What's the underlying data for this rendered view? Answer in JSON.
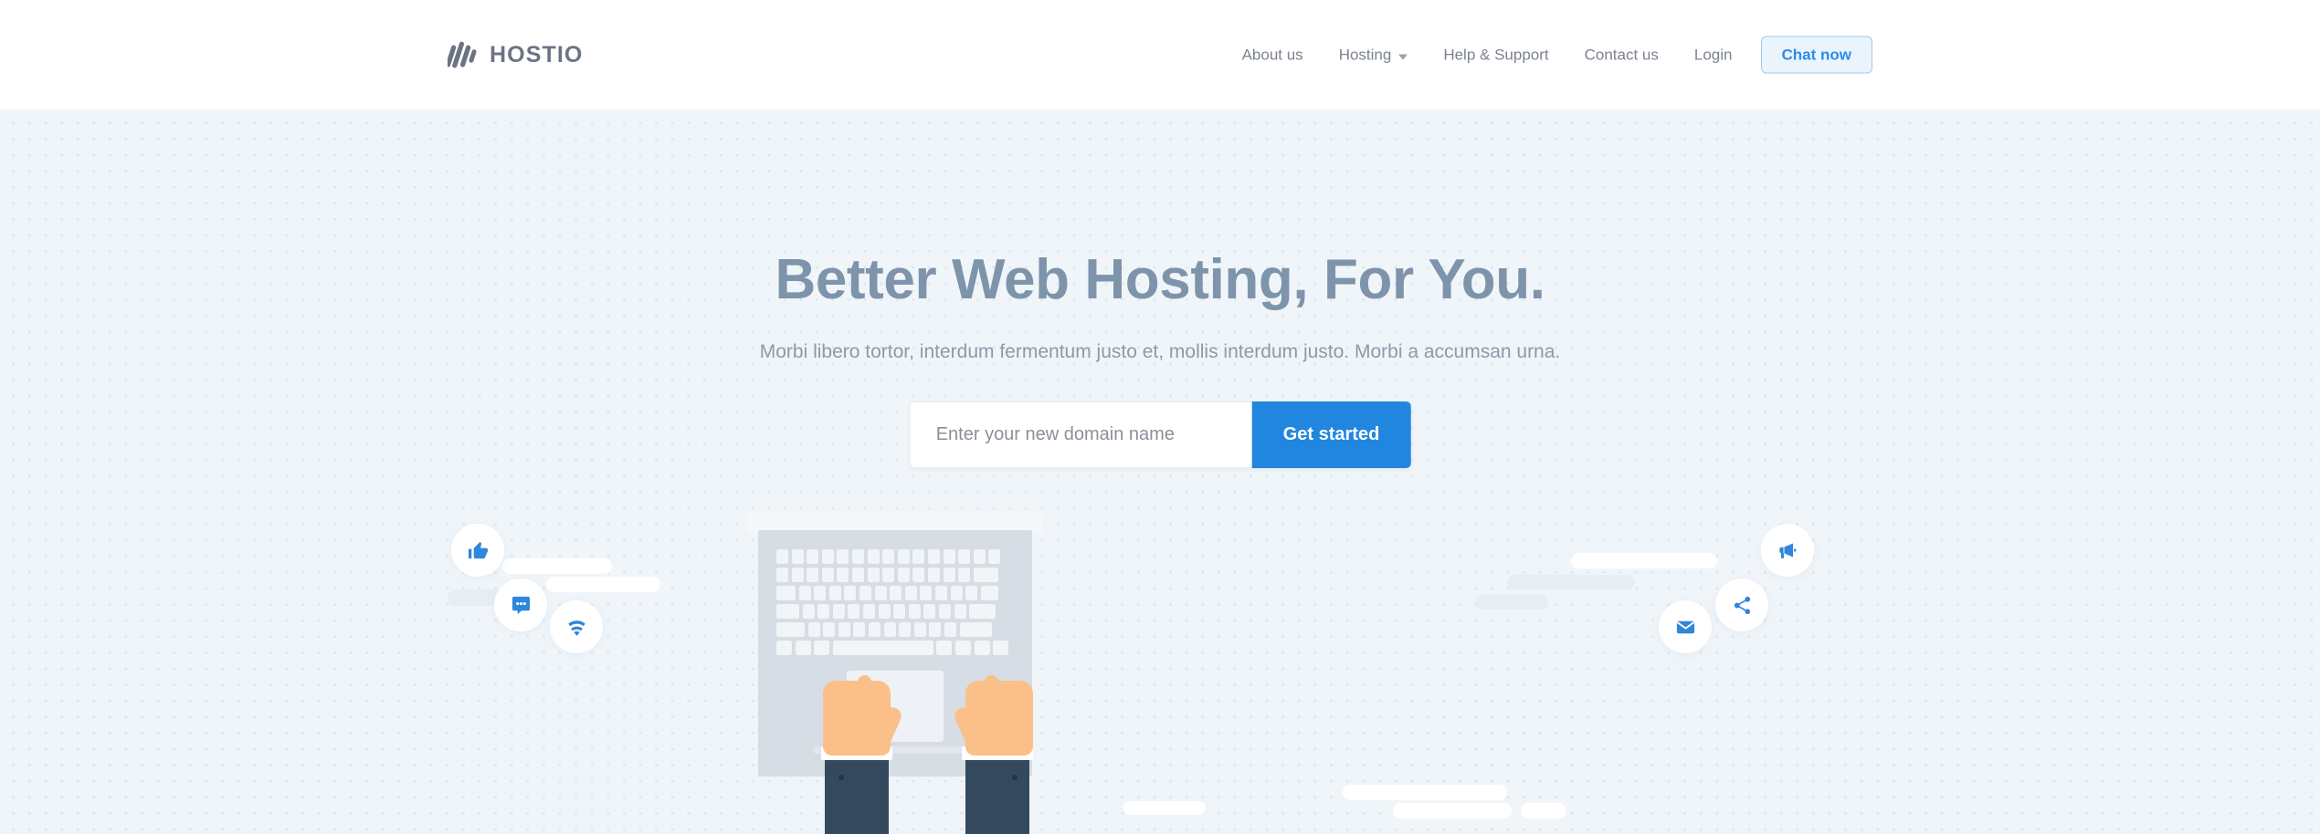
{
  "header": {
    "brand": {
      "name": "HOSTIO",
      "mark_icon": "hostio-slash-logo"
    },
    "nav": [
      {
        "label": "About us",
        "has_dropdown": false
      },
      {
        "label": "Hosting",
        "has_dropdown": true,
        "caret_icon": "chevron-down-icon"
      },
      {
        "label": "Help & Support",
        "has_dropdown": false
      },
      {
        "label": "Contact us",
        "has_dropdown": false
      },
      {
        "label": "Login",
        "has_dropdown": false
      }
    ],
    "chat_button": {
      "label": "Chat now"
    }
  },
  "hero": {
    "title": "Better Web Hosting, For You.",
    "subtitle": "Morbi libero tortor, interdum fermentum justo et, mollis interdum justo. Morbi a accumsan urna.",
    "form": {
      "input_placeholder": "Enter your new domain name",
      "input_value": "",
      "submit_label": "Get started"
    }
  },
  "illustration": {
    "name": "person-typing-on-laptop",
    "floating_icons": [
      {
        "name": "thumbs-up-icon",
        "position": "left-top"
      },
      {
        "name": "chat-bubble-icon",
        "position": "left-middle"
      },
      {
        "name": "wifi-icon",
        "position": "left-bottom"
      },
      {
        "name": "envelope-icon",
        "position": "right-bottom"
      },
      {
        "name": "share-icon",
        "position": "right-middle"
      },
      {
        "name": "megaphone-icon",
        "position": "right-top"
      }
    ]
  },
  "colors": {
    "accent_blue": "#2186e0",
    "icon_blue": "#2f86da",
    "heading_slate": "#7e94ab",
    "hero_background": "#f0f5f9",
    "dot_pattern": "#dfe7ee",
    "sleeve_navy": "#34495e",
    "skin": "#fbc08a",
    "header_background": "#ffffff",
    "nav_text": "#7c838f",
    "chat_button_background": "#eaf4fd",
    "chat_button_border": "#9ecbf0"
  }
}
